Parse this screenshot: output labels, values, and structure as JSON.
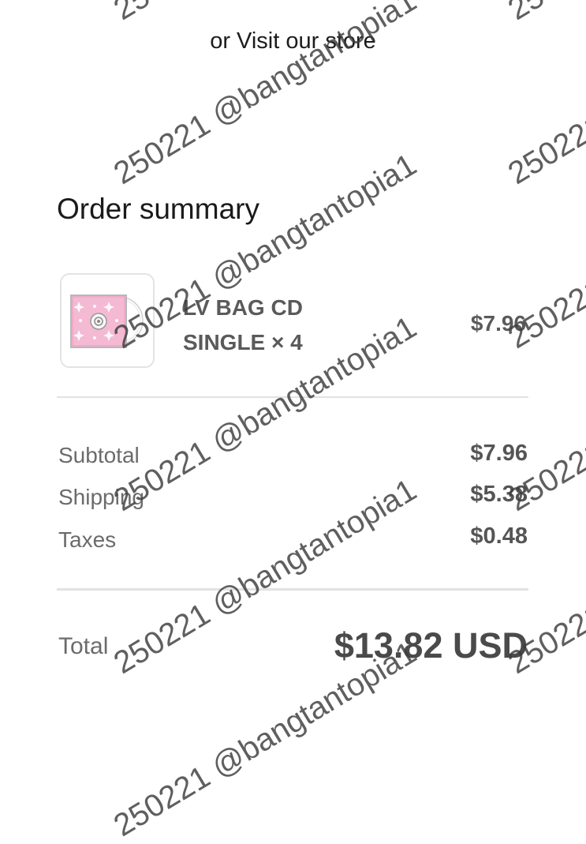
{
  "store_link": {
    "label": "or Visit our store"
  },
  "order_summary": {
    "title": "Order summary",
    "line_items": [
      {
        "name_line1": "LV BAG CD",
        "name_line2": "SINGLE × 4",
        "price": "$7.96",
        "thumbnail_icon": "pink-monogram-cd-cover-icon"
      }
    ],
    "subtotal": {
      "label": "Subtotal",
      "value": "$7.96"
    },
    "shipping": {
      "label": "Shipping",
      "value": "$5.38"
    },
    "taxes": {
      "label": "Taxes",
      "value": "$0.48"
    },
    "total": {
      "label": "Total",
      "value": "$13.82 USD"
    }
  },
  "watermark": {
    "text": "250221 @bangtantopia1"
  },
  "colors": {
    "cd_cover_pink": "#f4b9d3",
    "text_dark": "#1a1a1a",
    "text_muted": "#6b6b6b",
    "divider": "#e2e2e2"
  }
}
